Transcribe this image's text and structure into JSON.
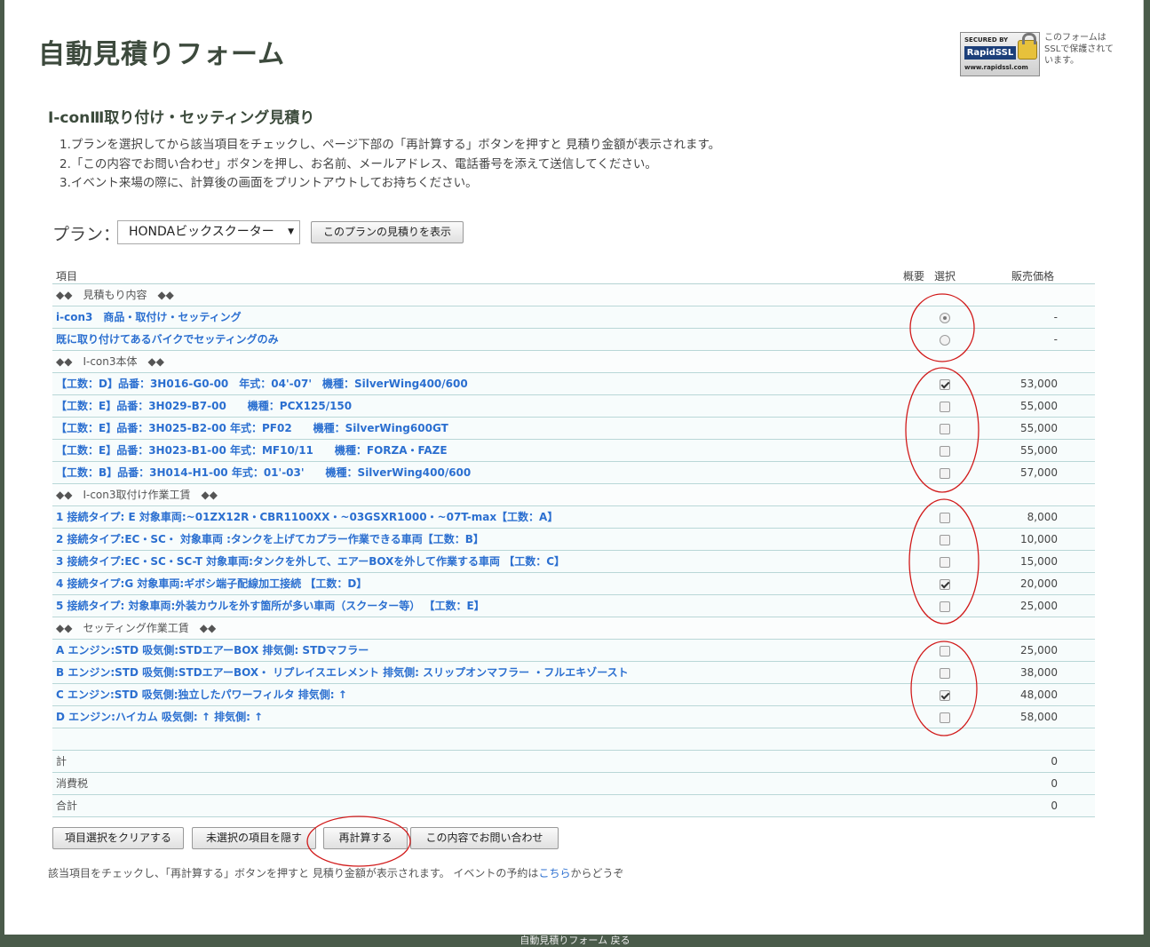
{
  "header": {
    "title": "自動見積りフォーム",
    "ssl_badge": {
      "line1": "SECURED BY",
      "line2": "RapidSSL",
      "line3": "www.rapidssl.com"
    },
    "ssl_note": "このフォームはSSLで保護されています。"
  },
  "subtitle": "I-conⅢ取り付け・セッティング見積り",
  "instructions": [
    "1.プランを選択してから該当項目をチェックし、ページ下部の「再計算する」ボタンを押すと 見積り金額が表示されます。",
    "2.「この内容でお問い合わせ」ボタンを押し、お名前、メールアドレス、電話番号を添えて送信してください。",
    "3.イベント来場の際に、計算後の画面をプリントアウトしてお持ちください。"
  ],
  "plan": {
    "label": "プラン：",
    "selected": "HONDAビックスクーター",
    "show_button": "このプランの見積りを表示"
  },
  "table": {
    "headers": {
      "item": "項目",
      "summary": "概要",
      "select": "選択",
      "price": "販売価格"
    },
    "rows": [
      {
        "type": "section",
        "label": "◆◆　見積もり内容　◆◆"
      },
      {
        "type": "radio",
        "label": "i-con3　商品・取付け・セッティング",
        "checked": true,
        "price": "-"
      },
      {
        "type": "radio",
        "label": "既に取り付けてあるバイクでセッティングのみ",
        "checked": false,
        "price": "-"
      },
      {
        "type": "section",
        "label": "◆◆　I-con3本体　◆◆"
      },
      {
        "type": "check",
        "label": "【工数：D】品番：3H016-G0-00　年式：04'-07'　機種：SilverWing400/600",
        "checked": true,
        "price": "53,000"
      },
      {
        "type": "check",
        "label": "【工数：E】品番：3H029-B7-00　　機種：PCX125/150",
        "checked": false,
        "price": "55,000"
      },
      {
        "type": "check",
        "label": "【工数：E】品番：3H025-B2-00 年式：PF02　　機種：SilverWing600GT",
        "checked": false,
        "price": "55,000"
      },
      {
        "type": "check",
        "label": "【工数：E】品番：3H023-B1-00 年式：MF10/11　　機種：FORZA・FAZE",
        "checked": false,
        "price": "55,000"
      },
      {
        "type": "check",
        "label": "【工数：B】品番：3H014-H1-00 年式：01'-03'　　機種：SilverWing400/600",
        "checked": false,
        "price": "57,000"
      },
      {
        "type": "section",
        "label": "◆◆　I-con3取付け作業工賃　◆◆"
      },
      {
        "type": "check",
        "label": "1 接続タイプ: E 対象車両:~01ZX12R・CBR1100XX・~03GSXR1000・~07T-max【工数：A】",
        "checked": false,
        "price": "8,000"
      },
      {
        "type": "check",
        "label": "2 接続タイプ:EC・SC・ 対象車両 :タンクを上げてカプラー作業できる車両【工数：B】",
        "checked": false,
        "price": "10,000"
      },
      {
        "type": "check",
        "label": "3 接続タイプ:EC・SC・SC-T 対象車両:タンクを外して、エアーBOXを外して作業する車両 【工数：C】",
        "checked": false,
        "price": "15,000"
      },
      {
        "type": "check",
        "label": "4 接続タイプ:G 対象車両:ギボシ端子配線加工接続 【工数：D】",
        "checked": true,
        "price": "20,000"
      },
      {
        "type": "check",
        "label": "5 接続タイプ: 対象車両:外装カウルを外す箇所が多い車両（スクーター等） 【工数：E】",
        "checked": false,
        "price": "25,000"
      },
      {
        "type": "section",
        "label": "◆◆　セッティング作業工賃　◆◆"
      },
      {
        "type": "check",
        "label": "A エンジン:STD 吸気側:STDエアーBOX 排気側: STDマフラー",
        "checked": false,
        "price": "25,000"
      },
      {
        "type": "check",
        "label": "B エンジン:STD 吸気側:STDエアーBOX・ リプレイスエレメント 排気側: スリップオンマフラー ・フルエキゾースト",
        "checked": false,
        "price": "38,000"
      },
      {
        "type": "check",
        "label": "C エンジン:STD 吸気側:独立したパワーフィルタ 排気側: ↑",
        "checked": true,
        "price": "48,000"
      },
      {
        "type": "check",
        "label": "D エンジン:ハイカム 吸気側: ↑ 排気側: ↑",
        "checked": false,
        "price": "58,000"
      }
    ],
    "totals": [
      {
        "label": "計",
        "value": "0"
      },
      {
        "label": "消費税",
        "value": "0"
      },
      {
        "label": "合計",
        "value": "0"
      }
    ]
  },
  "buttons": {
    "clear": "項目選択をクリアする",
    "hide_unselected": "未選択の項目を隠す",
    "recalculate": "再計算する",
    "inquire": "この内容でお問い合わせ"
  },
  "footer": {
    "note_before": "該当項目をチェックし、「再計算する」ボタンを押すと 見積り金額が表示されます。 イベントの予約は",
    "link": "こちら",
    "note_after": "からどうぞ",
    "bottom": "自動見積りフォーム 戻る"
  },
  "colors": {
    "link": "#2b6fd0",
    "annotation": "#d11a1a",
    "background": "#4a5b4a"
  }
}
